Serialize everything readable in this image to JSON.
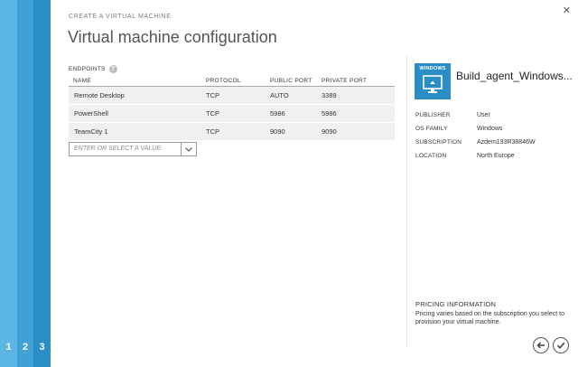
{
  "steps": [
    "1",
    "2",
    "3"
  ],
  "wizard": {
    "subtitle": "CREATE A VIRTUAL MACHINE",
    "title": "Virtual machine configuration"
  },
  "endpoints": {
    "heading": "ENDPOINTS",
    "columns": [
      "NAME",
      "PROTOCOL",
      "PUBLIC PORT",
      "PRIVATE PORT"
    ],
    "rows": [
      [
        "Remote Desktop",
        "TCP",
        "AUTO",
        "3389"
      ],
      [
        "PowerShell",
        "TCP",
        "5986",
        "5986"
      ],
      [
        "TeamCity 1",
        "TCP",
        "9090",
        "9090"
      ]
    ],
    "select_placeholder": "ENTER OR SELECT A VALUE"
  },
  "vm": {
    "tile_label": "WINDOWS",
    "name": "Build_agent_Windows...",
    "properties": [
      {
        "key": "PUBLISHER",
        "value": "User"
      },
      {
        "key": "OS FAMILY",
        "value": "Windows"
      },
      {
        "key": "SUBSCRIPTION",
        "value": "Azdem193R38846W"
      },
      {
        "key": "LOCATION",
        "value": "North Europe"
      }
    ]
  },
  "pricing": {
    "heading": "PRICING INFORMATION",
    "text": "Pricing varies based on the subscription you select to provision your virtual machine."
  },
  "colors": {
    "accent": "#2a8dc5",
    "rail_light": "#5bb6e4",
    "rail_mid": "#3fa1d6"
  },
  "icons": {
    "close": "close-icon",
    "help": "help-icon",
    "dropdown": "chevron-down-icon",
    "back": "back-arrow-icon",
    "ok": "checkmark-icon",
    "vm": "monitor-icon"
  }
}
